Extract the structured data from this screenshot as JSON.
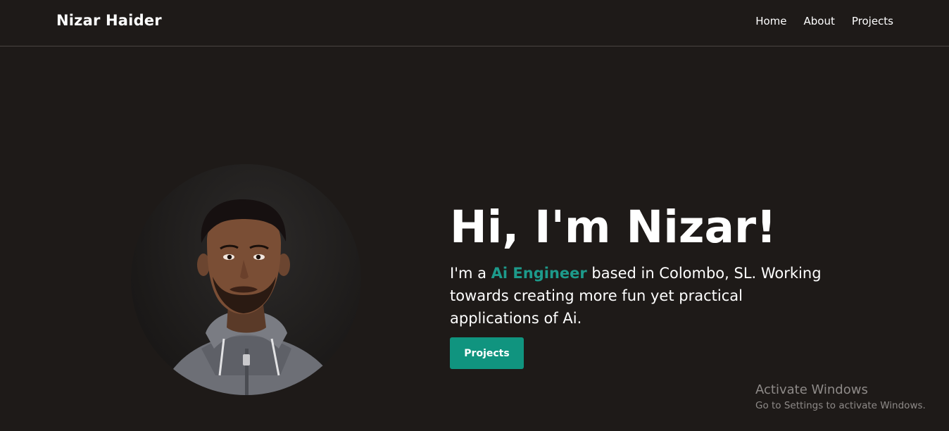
{
  "header": {
    "brand": "Nizar Haider",
    "nav": [
      {
        "label": "Home"
      },
      {
        "label": "About"
      },
      {
        "label": "Projects"
      }
    ]
  },
  "hero": {
    "title": "Hi, I'm Nizar!",
    "desc_prefix": "I'm a ",
    "desc_highlight": "Ai Engineer",
    "desc_suffix": " based in Colombo, SL. Working towards creating more fun yet practical applications of Ai.",
    "button_label": "Projects",
    "avatar_alt": "Portrait photo of Nizar Haider in a grey hoodie"
  },
  "watermark": {
    "title": "Activate Windows",
    "subtitle": "Go to Settings to activate Windows."
  },
  "colors": {
    "background": "#1e1a18",
    "accent": "#10947f",
    "highlight_text": "#1d9a8b",
    "divider": "#4a4542",
    "watermark_text": "#8e8a88"
  },
  "icons": {
    "avatar": "profile-photo"
  }
}
